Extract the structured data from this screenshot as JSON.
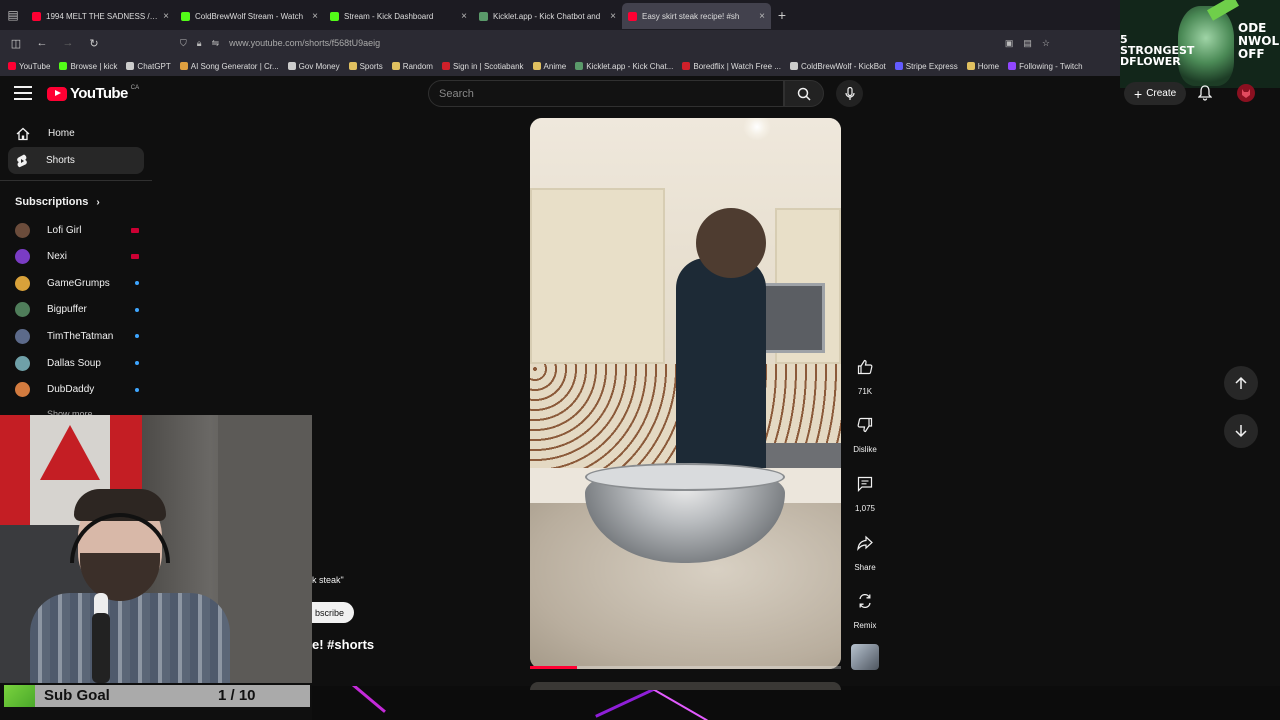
{
  "browser": {
    "tabs": [
      {
        "title": "1994 MELT THE SADNESS // D",
        "favicon_color": "#ff0033",
        "active": false
      },
      {
        "title": "ColdBrewWolf Stream - Watch",
        "favicon_color": "#53fc18",
        "active": false
      },
      {
        "title": "Stream - Kick Dashboard",
        "favicon_color": "#53fc18",
        "active": false
      },
      {
        "title": "Kicklet.app - Kick Chatbot and",
        "favicon_color": "#5a9a6a",
        "active": false
      },
      {
        "title": "Easy skirt steak recipe! #sh",
        "favicon_color": "#ff0033",
        "active": true
      }
    ],
    "url": "www.youtube.com/shorts/f568tU9aeig",
    "bookmarks": [
      {
        "label": "YouTube",
        "color": "#ff0033"
      },
      {
        "label": "Browse | kick",
        "color": "#53fc18"
      },
      {
        "label": "ChatGPT",
        "color": "#cccccc"
      },
      {
        "label": "AI Song Generator | Cr...",
        "color": "#e0a040"
      },
      {
        "label": "Gov Money",
        "color": "#cccccc"
      },
      {
        "label": "Sports",
        "color": "#e0c060"
      },
      {
        "label": "Random",
        "color": "#e0c060"
      },
      {
        "label": "Sign in | Scotiabank",
        "color": "#d0202a"
      },
      {
        "label": "Anime",
        "color": "#e0c060"
      },
      {
        "label": "Kicklet.app - Kick Chat...",
        "color": "#5a9a6a"
      },
      {
        "label": "Boredflix | Watch Free ...",
        "color": "#d0202a"
      },
      {
        "label": "ColdBrewWolf - KickBot",
        "color": "#cccccc"
      },
      {
        "label": "Stripe Express",
        "color": "#635bff"
      },
      {
        "label": "Home",
        "color": "#e0c060"
      },
      {
        "label": "Following - Twitch",
        "color": "#9146ff"
      }
    ]
  },
  "overlay_ad": {
    "left_text": "5 STRONGEST DFLOWER",
    "right_text": "ODE NWOLF OFF"
  },
  "header": {
    "logo_text": "YouTube",
    "country": "CA",
    "search_placeholder": "Search",
    "create_label": "Create"
  },
  "sidebar": {
    "home": "Home",
    "shorts": "Shorts",
    "subscriptions_title": "Subscriptions",
    "subscriptions": [
      {
        "name": "Lofi Girl",
        "status": "live",
        "avatar_color": "#6b4c3b"
      },
      {
        "name": "Nexi",
        "status": "live",
        "avatar_color": "#7a3cc4"
      },
      {
        "name": "GameGrumps",
        "status": "new",
        "avatar_color": "#d8a13a"
      },
      {
        "name": "Bigpuffer",
        "status": "new",
        "avatar_color": "#4f7d5a"
      },
      {
        "name": "TimTheTatman",
        "status": "new",
        "avatar_color": "#5c6a8a"
      },
      {
        "name": "Dallas Soup",
        "status": "new",
        "avatar_color": "#6fa0a8"
      },
      {
        "name": "DubDaddy",
        "status": "new",
        "avatar_color": "#d27b3f"
      }
    ],
    "show_more": "Show more"
  },
  "video_meta": {
    "desc_snippet": "k steak\"",
    "subscribe_snippet": "bscribe",
    "title_snippet": "e! #shorts"
  },
  "actions": {
    "like_count": "71K",
    "dislike_label": "Dislike",
    "comments_count": "1,075",
    "share_label": "Share",
    "remix_label": "Remix"
  },
  "playback": {
    "progress": 0.15
  },
  "stream_overlay": {
    "sub_goal_label": "Sub Goal",
    "sub_goal_count": "1 / 10",
    "sub_goal_progress": 0.1
  }
}
